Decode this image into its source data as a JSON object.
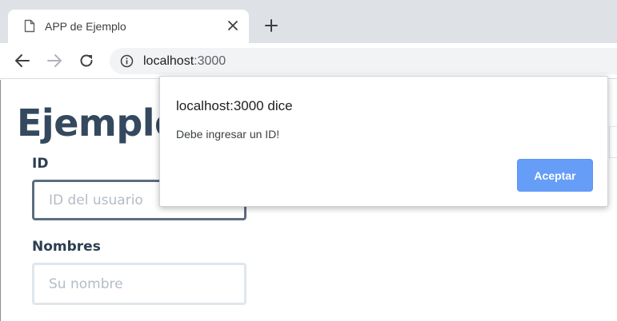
{
  "browser": {
    "tab": {
      "title": "APP de Ejemplo",
      "page_icon": "page-icon",
      "close_icon": "close-icon"
    },
    "new_tab_icon": "plus-icon",
    "nav": {
      "back_icon": "arrow-left-icon",
      "forward_icon": "arrow-right-icon",
      "reload_icon": "reload-icon"
    },
    "address_bar": {
      "info_icon": "info-icon",
      "host": "localhost",
      "port": ":3000"
    }
  },
  "page": {
    "title": "Ejemplo",
    "fields": [
      {
        "label": "ID",
        "placeholder": "ID del usuario",
        "value": ""
      },
      {
        "label": "Nombres",
        "placeholder": "Su nombre",
        "value": ""
      }
    ]
  },
  "dialog": {
    "title": "localhost:3000 dice",
    "message": "Debe ingresar un ID!",
    "ok_label": "Aceptar"
  },
  "colors": {
    "chrome_background": "#dee1e6",
    "omnibox_background": "#f1f3f4",
    "heading_text": "#34495e",
    "input_border": "#dfe6ec",
    "focused_input_border": "#5d6d7e",
    "dialog_button": "#669df6"
  }
}
